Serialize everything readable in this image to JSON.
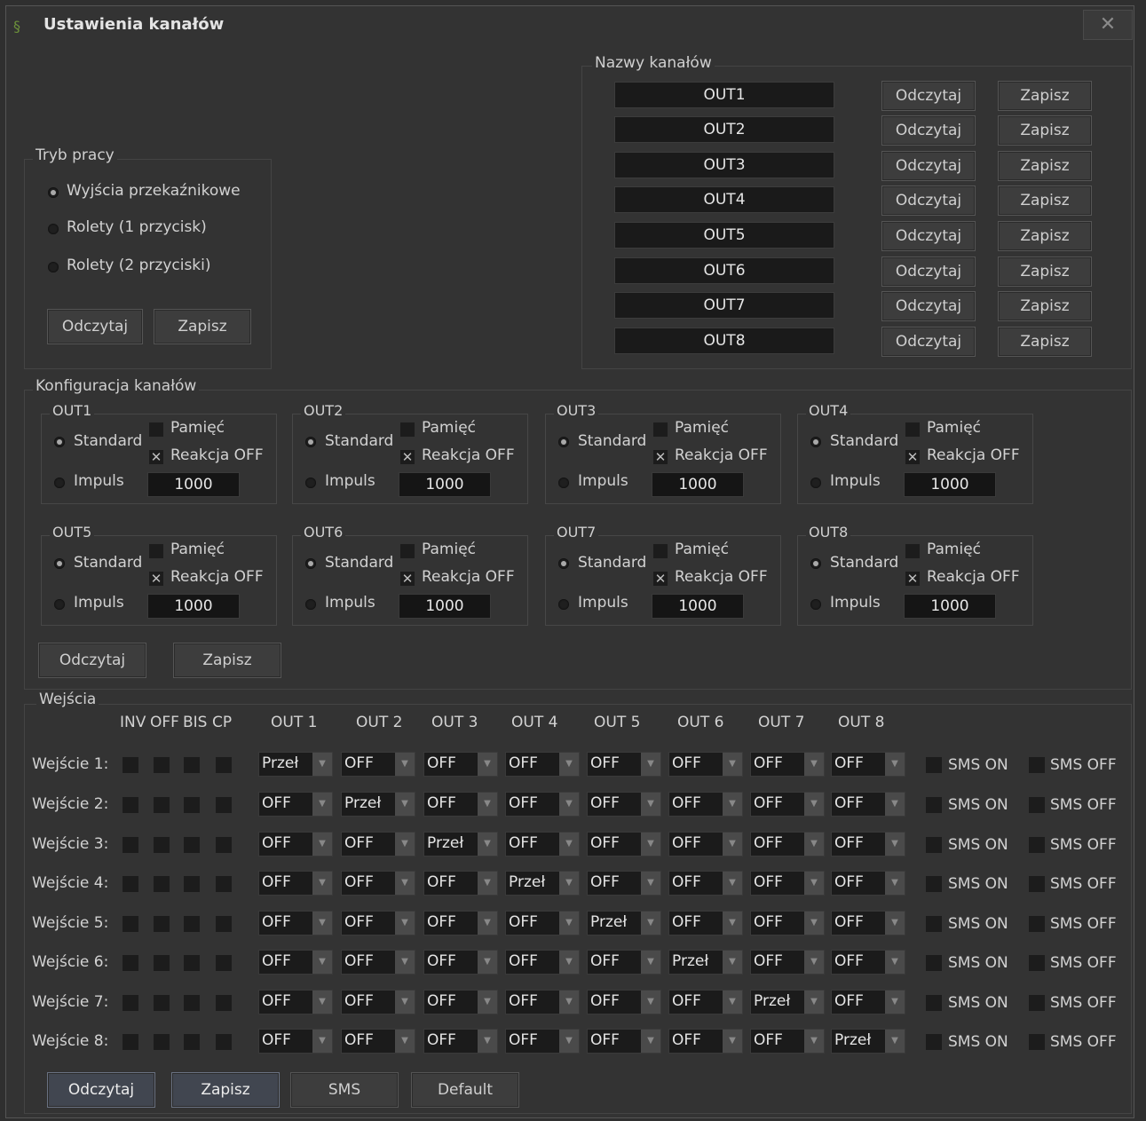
{
  "window": {
    "title": "Ustawienia kanałów",
    "close_glyph": "✕",
    "icon": "app-icon"
  },
  "names": {
    "label": "Nazwy kanałów",
    "rows": [
      {
        "value": "OUT1",
        "read": "Odczytaj",
        "write": "Zapisz"
      },
      {
        "value": "OUT2",
        "read": "Odczytaj",
        "write": "Zapisz"
      },
      {
        "value": "OUT3",
        "read": "Odczytaj",
        "write": "Zapisz"
      },
      {
        "value": "OUT4",
        "read": "Odczytaj",
        "write": "Zapisz"
      },
      {
        "value": "OUT5",
        "read": "Odczytaj",
        "write": "Zapisz"
      },
      {
        "value": "OUT6",
        "read": "Odczytaj",
        "write": "Zapisz"
      },
      {
        "value": "OUT7",
        "read": "Odczytaj",
        "write": "Zapisz"
      },
      {
        "value": "OUT8",
        "read": "Odczytaj",
        "write": "Zapisz"
      }
    ]
  },
  "mode": {
    "label": "Tryb pracy",
    "options": [
      "Wyjścia przekaźnikowe",
      "Rolety (1 przycisk)",
      "Rolety (2 przyciski)"
    ],
    "selected": 0,
    "read": "Odczytaj",
    "write": "Zapisz"
  },
  "config": {
    "label": "Konfiguracja kanałów",
    "channels": [
      {
        "name": "OUT1",
        "standard": "Standard",
        "impuls": "Impuls",
        "pamiec": "Pamięć",
        "reakcja": "Reakcja OFF",
        "pamiec_checked": false,
        "reakcja_checked": true,
        "value": "1000",
        "mode": "standard"
      },
      {
        "name": "OUT2",
        "standard": "Standard",
        "impuls": "Impuls",
        "pamiec": "Pamięć",
        "reakcja": "Reakcja OFF",
        "pamiec_checked": false,
        "reakcja_checked": true,
        "value": "1000",
        "mode": "standard"
      },
      {
        "name": "OUT3",
        "standard": "Standard",
        "impuls": "Impuls",
        "pamiec": "Pamięć",
        "reakcja": "Reakcja OFF",
        "pamiec_checked": false,
        "reakcja_checked": true,
        "value": "1000",
        "mode": "standard"
      },
      {
        "name": "OUT4",
        "standard": "Standard",
        "impuls": "Impuls",
        "pamiec": "Pamięć",
        "reakcja": "Reakcja OFF",
        "pamiec_checked": false,
        "reakcja_checked": true,
        "value": "1000",
        "mode": "standard"
      },
      {
        "name": "OUT5",
        "standard": "Standard",
        "impuls": "Impuls",
        "pamiec": "Pamięć",
        "reakcja": "Reakcja OFF",
        "pamiec_checked": false,
        "reakcja_checked": true,
        "value": "1000",
        "mode": "standard"
      },
      {
        "name": "OUT6",
        "standard": "Standard",
        "impuls": "Impuls",
        "pamiec": "Pamięć",
        "reakcja": "Reakcja OFF",
        "pamiec_checked": false,
        "reakcja_checked": true,
        "value": "1000",
        "mode": "standard"
      },
      {
        "name": "OUT7",
        "standard": "Standard",
        "impuls": "Impuls",
        "pamiec": "Pamięć",
        "reakcja": "Reakcja OFF",
        "pamiec_checked": false,
        "reakcja_checked": true,
        "value": "1000",
        "mode": "standard"
      },
      {
        "name": "OUT8",
        "standard": "Standard",
        "impuls": "Impuls",
        "pamiec": "Pamięć",
        "reakcja": "Reakcja OFF",
        "pamiec_checked": false,
        "reakcja_checked": true,
        "value": "1000",
        "mode": "standard"
      }
    ],
    "read": "Odczytaj",
    "write": "Zapisz"
  },
  "inputs": {
    "label": "Wejścia",
    "flag_headers": [
      "INV",
      "OFF",
      "BIS",
      "CP"
    ],
    "out_headers": [
      "OUT 1",
      "OUT 2",
      "OUT 3",
      "OUT 4",
      "OUT 5",
      "OUT 6",
      "OUT 7",
      "OUT 8"
    ],
    "sms_on": "SMS ON",
    "sms_off": "SMS OFF",
    "rows": [
      {
        "label": "Wejście 1:",
        "outs": [
          "Przeł",
          "OFF",
          "OFF",
          "OFF",
          "OFF",
          "OFF",
          "OFF",
          "OFF"
        ]
      },
      {
        "label": "Wejście 2:",
        "outs": [
          "OFF",
          "Przeł",
          "OFF",
          "OFF",
          "OFF",
          "OFF",
          "OFF",
          "OFF"
        ]
      },
      {
        "label": "Wejście 3:",
        "outs": [
          "OFF",
          "OFF",
          "Przeł",
          "OFF",
          "OFF",
          "OFF",
          "OFF",
          "OFF"
        ]
      },
      {
        "label": "Wejście 4:",
        "outs": [
          "OFF",
          "OFF",
          "OFF",
          "Przeł",
          "OFF",
          "OFF",
          "OFF",
          "OFF"
        ]
      },
      {
        "label": "Wejście 5:",
        "outs": [
          "OFF",
          "OFF",
          "OFF",
          "OFF",
          "Przeł",
          "OFF",
          "OFF",
          "OFF"
        ]
      },
      {
        "label": "Wejście 6:",
        "outs": [
          "OFF",
          "OFF",
          "OFF",
          "OFF",
          "OFF",
          "Przeł",
          "OFF",
          "OFF"
        ]
      },
      {
        "label": "Wejście 7:",
        "outs": [
          "OFF",
          "OFF",
          "OFF",
          "OFF",
          "OFF",
          "OFF",
          "Przeł",
          "OFF"
        ]
      },
      {
        "label": "Wejście 8:",
        "outs": [
          "OFF",
          "OFF",
          "OFF",
          "OFF",
          "OFF",
          "OFF",
          "OFF",
          "Przeł"
        ]
      }
    ]
  },
  "footer": {
    "read": "Odczytaj",
    "write": "Zapisz",
    "sms": "SMS",
    "default": "Default"
  }
}
